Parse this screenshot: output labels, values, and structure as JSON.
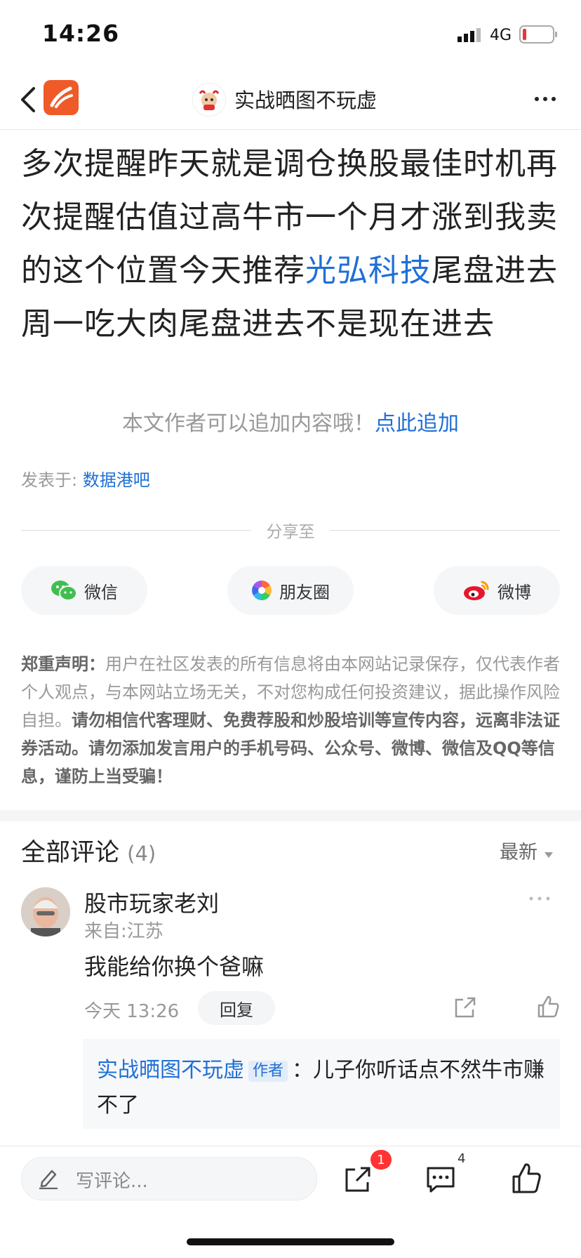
{
  "status_bar": {
    "time": "14:26",
    "network": "4G"
  },
  "header": {
    "title": "实战晒图不玩虚"
  },
  "post": {
    "text_before": "多次提醒昨天就是调仓换股最佳时机再次提醒估值过高牛市一个月才涨到我卖的这个位置今天推荐",
    "stock_link": "光弘科技",
    "text_after": "尾盘进去周一吃大肉尾盘进去不是现在进去"
  },
  "append_hint": {
    "text": "本文作者可以追加内容哦！",
    "link": "点此追加"
  },
  "posted_in": {
    "label": "发表于:",
    "forum": "数据港吧"
  },
  "share": {
    "label": "分享至",
    "buttons": [
      {
        "label": "微信",
        "icon": "wechat-icon"
      },
      {
        "label": "朋友圈",
        "icon": "moments-icon"
      },
      {
        "label": "微博",
        "icon": "weibo-icon"
      }
    ]
  },
  "disclaimer": {
    "title": "郑重声明：",
    "normal": "用户在社区发表的所有信息将由本网站记录保存，仅代表作者个人观点，与本网站立场无关，不对您构成任何投资建议，据此操作风险自担。",
    "bold": "请勿相信代客理财、免费荐股和炒股培训等宣传内容，远离非法证券活动。请勿添加发言用户的手机号码、公众号、微博、微信及QQ等信息，谨防上当受骗！"
  },
  "comments": {
    "title": "全部评论",
    "count": "(4)",
    "sort": "最新",
    "items": [
      {
        "user": "股市玩家老刘",
        "location": "来自:江苏",
        "text": "我能给你换个爸嘛",
        "time": "今天 13:26",
        "reply_label": "回复",
        "reply": {
          "author": "实战晒图不玩虚",
          "tag": "作者",
          "separator": "：",
          "text": "儿子你听话点不然牛市赚不了"
        }
      }
    ]
  },
  "bottom_bar": {
    "placeholder": "写评论...",
    "share_badge": "1",
    "comment_count": "4"
  },
  "colors": {
    "link": "#1f6fd6",
    "badge": "#ff3333",
    "app_logo": "#f05a28"
  }
}
